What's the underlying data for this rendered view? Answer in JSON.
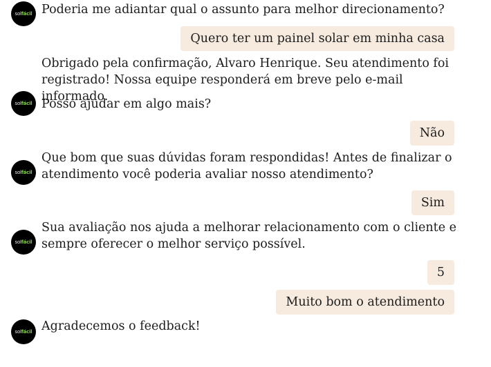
{
  "brand": {
    "logo_part1": "sol",
    "logo_part2": "fácil",
    "logo_color": "#7bd336"
  },
  "colors": {
    "user_bubble_bg": "#f7ebdf",
    "avatar_bg": "#000000",
    "text": "#1c1c1c"
  },
  "messages": [
    {
      "from": "bot",
      "text": "Poderia me adiantar qual o assunto para melhor direcionamento?"
    },
    {
      "from": "user",
      "text": "Quero ter um painel solar em minha casa"
    },
    {
      "from": "bot",
      "text": "Obrigado pela confirmação, Alvaro Henrique. Seu atendimento foi\nregistrado! Nossa equipe responderá em breve pelo e-mail informado."
    },
    {
      "from": "bot",
      "text": "Posso ajudar em algo mais?"
    },
    {
      "from": "user",
      "text": "Não"
    },
    {
      "from": "bot",
      "text": "Que bom que suas dúvidas foram respondidas! Antes de finalizar o\natendimento você poderia avaliar nosso atendimento?"
    },
    {
      "from": "user",
      "text": "Sim"
    },
    {
      "from": "bot",
      "text": "Sua avaliação nos ajuda a melhorar relacionamento com o cliente e\nsempre oferecer o melhor serviço possível."
    },
    {
      "from": "user",
      "text": "5"
    },
    {
      "from": "user",
      "text": "Muito bom o atendimento"
    },
    {
      "from": "bot",
      "text": "Agradecemos o feedback!"
    }
  ]
}
